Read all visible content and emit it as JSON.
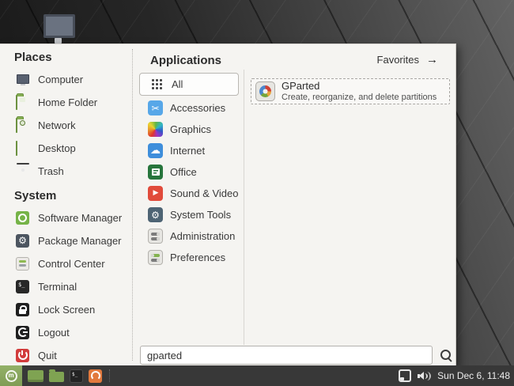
{
  "menu": {
    "places": {
      "header": "Places",
      "items": [
        {
          "label": "Computer",
          "icon": "computer-icon"
        },
        {
          "label": "Home Folder",
          "icon": "home-folder-icon"
        },
        {
          "label": "Network",
          "icon": "network-icon"
        },
        {
          "label": "Desktop",
          "icon": "desktop-icon"
        },
        {
          "label": "Trash",
          "icon": "trash-icon"
        }
      ]
    },
    "system": {
      "header": "System",
      "items": [
        {
          "label": "Software Manager",
          "icon": "software-manager-icon"
        },
        {
          "label": "Package Manager",
          "icon": "package-manager-icon",
          "glyph": "⚙"
        },
        {
          "label": "Control Center",
          "icon": "control-center-icon"
        },
        {
          "label": "Terminal",
          "icon": "terminal-icon",
          "glyph": "$_"
        },
        {
          "label": "Lock Screen",
          "icon": "lock-screen-icon"
        },
        {
          "label": "Logout",
          "icon": "logout-icon"
        },
        {
          "label": "Quit",
          "icon": "quit-icon"
        }
      ]
    },
    "applications": {
      "header": "Applications",
      "categories": [
        {
          "label": "All",
          "icon": "all-grid-icon",
          "selected": true
        },
        {
          "label": "Accessories",
          "icon": "accessories-icon",
          "glyph": "✂"
        },
        {
          "label": "Graphics",
          "icon": "graphics-icon"
        },
        {
          "label": "Internet",
          "icon": "internet-icon",
          "glyph": "☁"
        },
        {
          "label": "Office",
          "icon": "office-icon"
        },
        {
          "label": "Sound & Video",
          "icon": "sound-video-icon",
          "glyph": "▶"
        },
        {
          "label": "System Tools",
          "icon": "system-tools-icon",
          "glyph": "⚙"
        },
        {
          "label": "Administration",
          "icon": "administration-icon"
        },
        {
          "label": "Preferences",
          "icon": "preferences-icon"
        }
      ]
    },
    "favorites": {
      "label": "Favorites",
      "arrow": "→"
    },
    "results": [
      {
        "title": "GParted",
        "subtitle": "Create, reorganize, and delete partitions",
        "icon": "gparted-icon"
      }
    ],
    "search": {
      "value": "gparted",
      "icon": "search-icon"
    }
  },
  "taskbar": {
    "menu_button": "mint-menu-button",
    "launchers": [
      "show-desktop-icon",
      "file-manager-icon",
      "terminal-icon",
      "orange-app-icon"
    ],
    "tray": [
      "window-list-icon",
      "volume-icon"
    ],
    "clock": "Sun Dec 6, 11:48"
  },
  "colors": {
    "panel_bg": "#f5f4f1",
    "taskbar_bg": "#383838",
    "mint_green": "#87a556",
    "folder_green": "#85ae53",
    "quit_red": "#d23c3c",
    "text": "#3a3a3a"
  }
}
